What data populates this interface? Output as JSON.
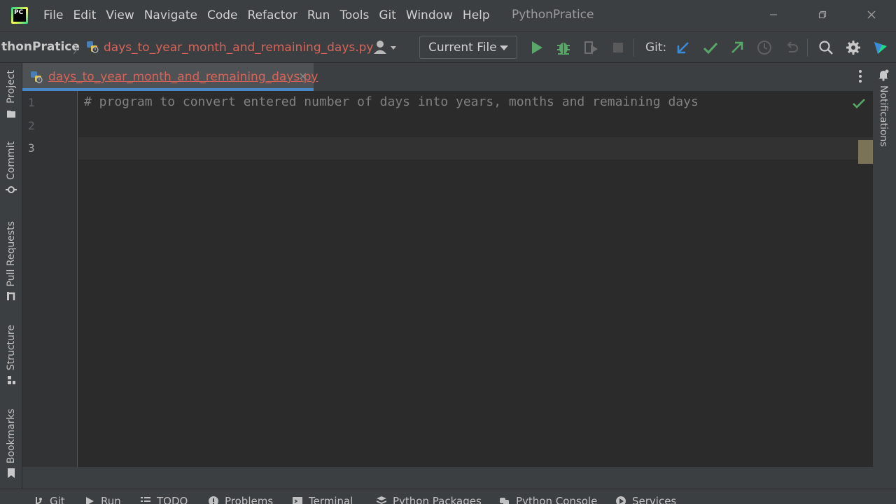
{
  "window": {
    "title": "PythonPratice",
    "logo_text": "PC"
  },
  "menu": {
    "items": [
      "File",
      "Edit",
      "View",
      "Navigate",
      "Code",
      "Refactor",
      "Run",
      "Tools",
      "Git",
      "Window",
      "Help"
    ]
  },
  "toolbar": {
    "project": "thonPratice",
    "file": "days_to_year_month_and_remaining_days.py",
    "run_config": "Current File",
    "git_label": "Git:"
  },
  "left_tools": [
    "Project",
    "Commit",
    "Pull Requests",
    "Structure",
    "Bookmarks"
  ],
  "right_tools": [
    "Notifications"
  ],
  "editor": {
    "tab_name": "days_to_year_month_and_remaining_days.py",
    "close_glyph": "×",
    "line_numbers": [
      "1",
      "2",
      "3"
    ],
    "current_line": 3,
    "lines": [
      "# program to convert entered number of days into years, months and remaining days",
      "",
      ""
    ]
  },
  "bottom_tools": [
    "Git",
    "Run",
    "TODO",
    "Problems",
    "Terminal",
    "Python Packages",
    "Python Console",
    "Services"
  ],
  "colors": {
    "accent_blue": "#4a88c7",
    "file_error_red": "#d76458",
    "run_green": "#59a869",
    "comment_gray": "#808080"
  }
}
